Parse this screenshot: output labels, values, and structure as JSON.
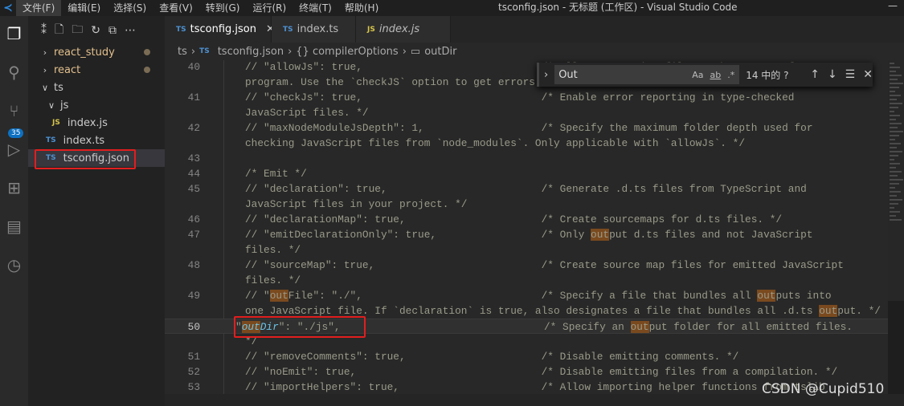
{
  "titlebar": {
    "menus": [
      "文件(F)",
      "编辑(E)",
      "选择(S)",
      "查看(V)",
      "转到(G)",
      "运行(R)",
      "终端(T)",
      "帮助(H)"
    ],
    "title": "tsconfig.json - 无标题 (工作区) - Visual Studio Code"
  },
  "activity": {
    "badge": "35",
    "icons": [
      "files-icon",
      "search-icon",
      "source-control-icon",
      "run-debug-icon",
      "extensions-icon",
      "remote-explorer-icon",
      "timeline-icon"
    ]
  },
  "explorer": {
    "items": [
      {
        "label": "react_study",
        "type": "folder",
        "open": false,
        "depth": 0,
        "dot": true
      },
      {
        "label": "react",
        "type": "folder",
        "open": false,
        "depth": 0,
        "dot": true
      },
      {
        "label": "ts",
        "type": "folder",
        "open": true,
        "depth": 0
      },
      {
        "label": "js",
        "type": "folder",
        "open": true,
        "depth": 1
      },
      {
        "label": "index.js",
        "type": "js",
        "depth": 2
      },
      {
        "label": "index.ts",
        "type": "ts",
        "depth": 1
      },
      {
        "label": "tsconfig.json",
        "type": "ts",
        "depth": 1,
        "selected": true
      }
    ]
  },
  "tabs": [
    {
      "label": "tsconfig.json",
      "icon": "TS",
      "active": true
    },
    {
      "label": "index.ts",
      "icon": "TS"
    },
    {
      "label": "index.js",
      "icon": "JS",
      "italic": true
    }
  ],
  "breadcrumb": [
    "ts",
    "tsconfig.json",
    "{} compilerOptions",
    "outDir"
  ],
  "find": {
    "value": "Out",
    "opt_case": "Aa",
    "opt_word": "ab",
    "opt_regex": ".*",
    "count": "14 中的 ?"
  },
  "editor": {
    "rows": [
      {
        "n": "40",
        "code": "// \"allowJs\": true,                             /* Allow JavaScript files to be a part of your"
      },
      {
        "n": "",
        "code": "program. Use the `checkJS` option to get errors from these files. */"
      },
      {
        "n": "41",
        "code": "// \"checkJs\": true,                             /* Enable error reporting in type-checked"
      },
      {
        "n": "",
        "code": "JavaScript files. */"
      },
      {
        "n": "42",
        "code": "// \"maxNodeModuleJsDepth\": 1,                   /* Specify the maximum folder depth used for"
      },
      {
        "n": "",
        "code": "checking JavaScript files from `node_modules`. Only applicable with `allowJs`. */"
      },
      {
        "n": "43",
        "code": ""
      },
      {
        "n": "44",
        "code": "/* Emit */"
      },
      {
        "n": "45",
        "code": "// \"declaration\": true,                         /* Generate .d.ts files from TypeScript and"
      },
      {
        "n": "",
        "code": "JavaScript files in your project. */"
      },
      {
        "n": "46",
        "code": "// \"declarationMap\": true,                      /* Create sourcemaps for d.ts files. */"
      },
      {
        "n": "47",
        "code": "// \"emitDeclarationOnly\": true,                 /* Only output d.ts files and not JavaScript"
      },
      {
        "n": "",
        "code": "files. */"
      },
      {
        "n": "48",
        "code": "// \"sourceMap\": true,                           /* Create source map files for emitted JavaScript"
      },
      {
        "n": "",
        "code": "files. */"
      },
      {
        "n": "49",
        "code": "// \"outFile\": \"./\",                             /* Specify a file that bundles all outputs into"
      },
      {
        "n": "",
        "code": "one JavaScript file. If `declaration` is true, also designates a file that bundles all .d.ts output. */"
      },
      {
        "n": "50",
        "code": "\"outDir\": \"./js\",                                 /* Specify an output folder for all emitted files.",
        "current": true
      },
      {
        "n": "",
        "code": "*/"
      },
      {
        "n": "51",
        "code": "// \"removeComments\": true,                      /* Disable emitting comments. */"
      },
      {
        "n": "52",
        "code": "// \"noEmit\": true,                              /* Disable emitting files from a compilation. */"
      },
      {
        "n": "53",
        "code": "// \"importHelpers\": true,                       /* Allow importing helper functions from tslib"
      }
    ]
  },
  "watermark": "CSDN @Cupid510",
  "colors": {
    "highlight_box": "#e21e1e",
    "match": "#7a4a1e",
    "key": "#6cc4e8"
  }
}
